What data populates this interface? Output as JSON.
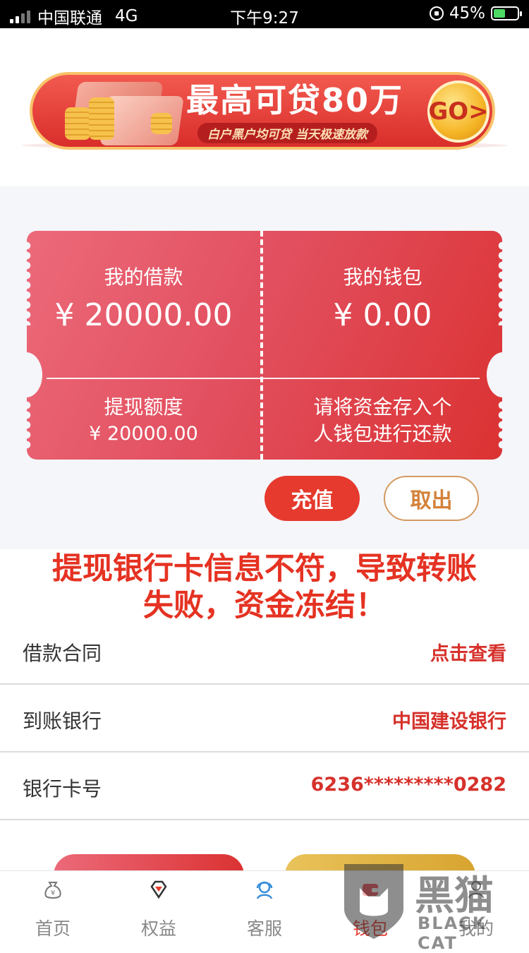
{
  "status_bar": {
    "carrier": "中国联通",
    "network": "4G",
    "time": "下午9:27",
    "battery": "45%"
  },
  "banner": {
    "title": "最高可贷80万",
    "subtitle": "白户黑户均可贷  当天极速放款",
    "go": "GO>"
  },
  "ticket": {
    "loan_label": "我的借款",
    "loan_value": "¥ 20000.00",
    "wallet_label": "我的钱包",
    "wallet_value": "¥ 0.00",
    "limit_label": "提现额度",
    "limit_value": "¥ 20000.00",
    "hint_line1": "请将资金存入个",
    "hint_line2": "人钱包进行还款"
  },
  "actions": {
    "charge": "充值",
    "withdraw": "取出"
  },
  "overlay": {
    "line1": "提现银行卡信息不符，导致转账",
    "line2": "失败，资金冻结！"
  },
  "rows": [
    {
      "key": "借款合同",
      "value": "点击查看"
    },
    {
      "key": "到账银行",
      "value": "中国建设银行"
    },
    {
      "key": "银行卡号",
      "value": "6236*********0282"
    }
  ],
  "tabs": [
    {
      "label": "首页",
      "icon": "money-bag-icon"
    },
    {
      "label": "权益",
      "icon": "diamond-icon"
    },
    {
      "label": "客服",
      "icon": "customer-service-icon"
    },
    {
      "label": "钱包",
      "icon": "wallet-icon"
    },
    {
      "label": "我的",
      "icon": "user-icon"
    }
  ],
  "watermark": {
    "cn": "黑猫",
    "en": "BLACK CAT"
  },
  "colors": {
    "primary": "#e53a2d",
    "accent_text": "#d6312b",
    "gold": "#d3823a"
  }
}
